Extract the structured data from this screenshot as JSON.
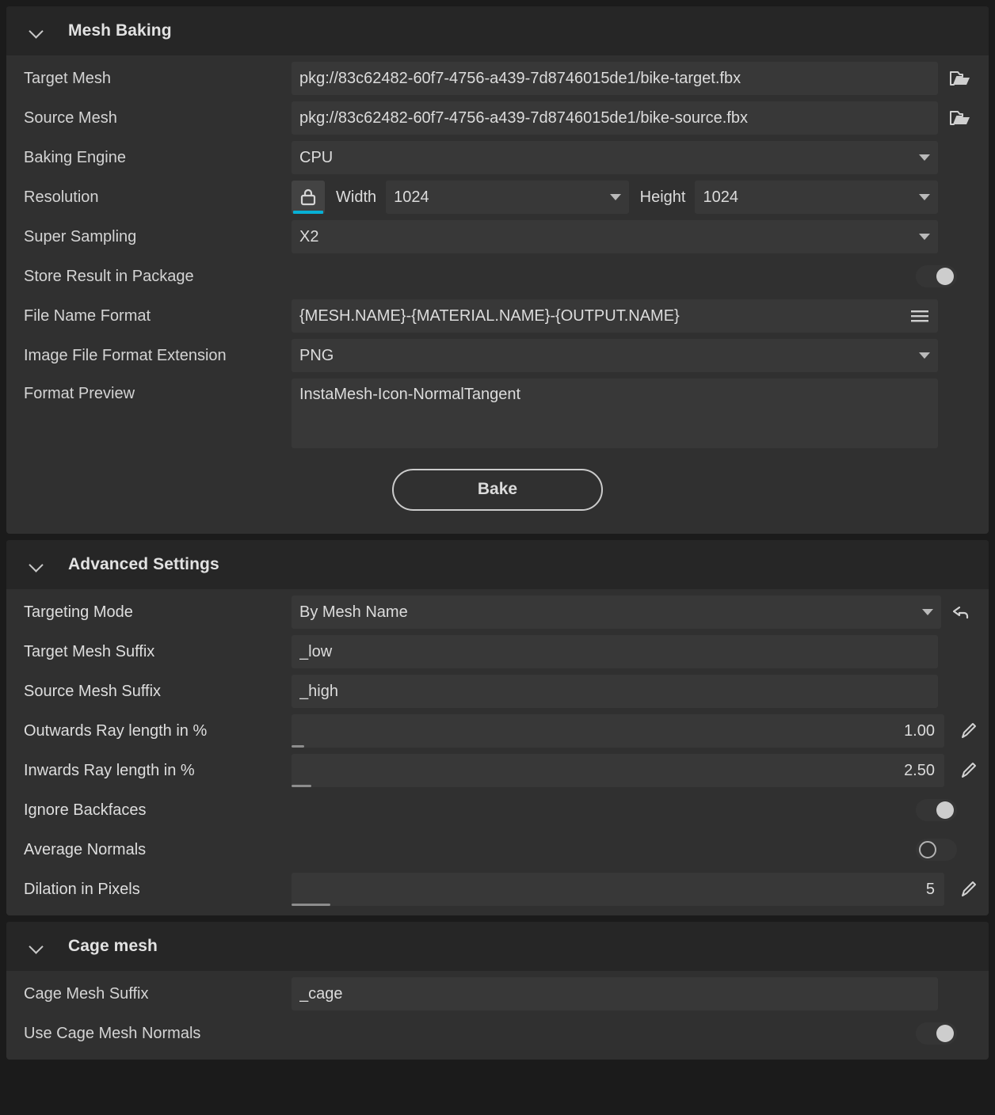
{
  "sections": [
    {
      "title": "Mesh Baking",
      "chevron_icon": "chevron-down-icon",
      "rows": [
        {
          "label": "Target Mesh",
          "value": "pkg://83c62482-60f7-4756-a439-7d8746015de1/bike-target.fbx",
          "trailing_icon": "folder-open-icon"
        },
        {
          "label": "Source Mesh",
          "value": "pkg://83c62482-60f7-4756-a439-7d8746015de1/bike-source.fbx",
          "trailing_icon": "folder-open-icon"
        },
        {
          "label": "Baking Engine",
          "value": "CPU",
          "trailing_icon": "chevron-down-icon"
        },
        {
          "label": "Resolution",
          "lock_icon": "lock-closed-icon",
          "width_label": "Width",
          "width_value": "1024",
          "height_label": "Height",
          "height_value": "1024"
        },
        {
          "label": "Super Sampling",
          "value": "X2",
          "trailing_icon": "chevron-down-icon"
        },
        {
          "label": "Store Result in Package",
          "toggle": "on"
        },
        {
          "label": "File Name Format",
          "value": "{MESH.NAME}-{MATERIAL.NAME}-{OUTPUT.NAME}",
          "trailing_icon": "hamburger-menu-icon"
        },
        {
          "label": "Image File Format Extension",
          "value": "PNG",
          "trailing_icon": "chevron-down-icon"
        },
        {
          "label": "Format Preview",
          "value": "InstaMesh-Icon-NormalTangent"
        }
      ],
      "action_label": "Bake"
    },
    {
      "title": "Advanced Settings",
      "chevron_icon": "chevron-down-icon",
      "rows": [
        {
          "label": "Targeting Mode",
          "value": "By Mesh Name",
          "trailing_icon": "chevron-down-icon",
          "reset_icon": "undo-arrow-icon"
        },
        {
          "label": "Target Mesh Suffix",
          "value": "_low"
        },
        {
          "label": "Source Mesh Suffix",
          "value": "_high"
        },
        {
          "label": "Outwards Ray length in %",
          "slider_value": "1.00",
          "fill_percent": 2,
          "edit_icon": "pencil-icon"
        },
        {
          "label": "Inwards Ray length in %",
          "slider_value": "2.50",
          "fill_percent": 3,
          "edit_icon": "pencil-icon"
        },
        {
          "label": "Ignore Backfaces",
          "toggle": "on"
        },
        {
          "label": "Average Normals",
          "toggle": "off"
        },
        {
          "label": "Dilation in Pixels",
          "slider_value": "5",
          "fill_percent": 6,
          "edit_icon": "pencil-icon"
        }
      ]
    },
    {
      "title": "Cage mesh",
      "chevron_icon": "chevron-down-icon",
      "rows": [
        {
          "label": "Cage Mesh Suffix",
          "value": "_cage"
        },
        {
          "label": "Use Cage Mesh Normals",
          "toggle": "on"
        }
      ]
    }
  ],
  "colors": {
    "page_background": "#1b1b1b",
    "panel_background": "#303030",
    "header_background": "#262626",
    "field_background": "#383838",
    "accent": "#07b0d5",
    "text": "#d4d4d4"
  }
}
